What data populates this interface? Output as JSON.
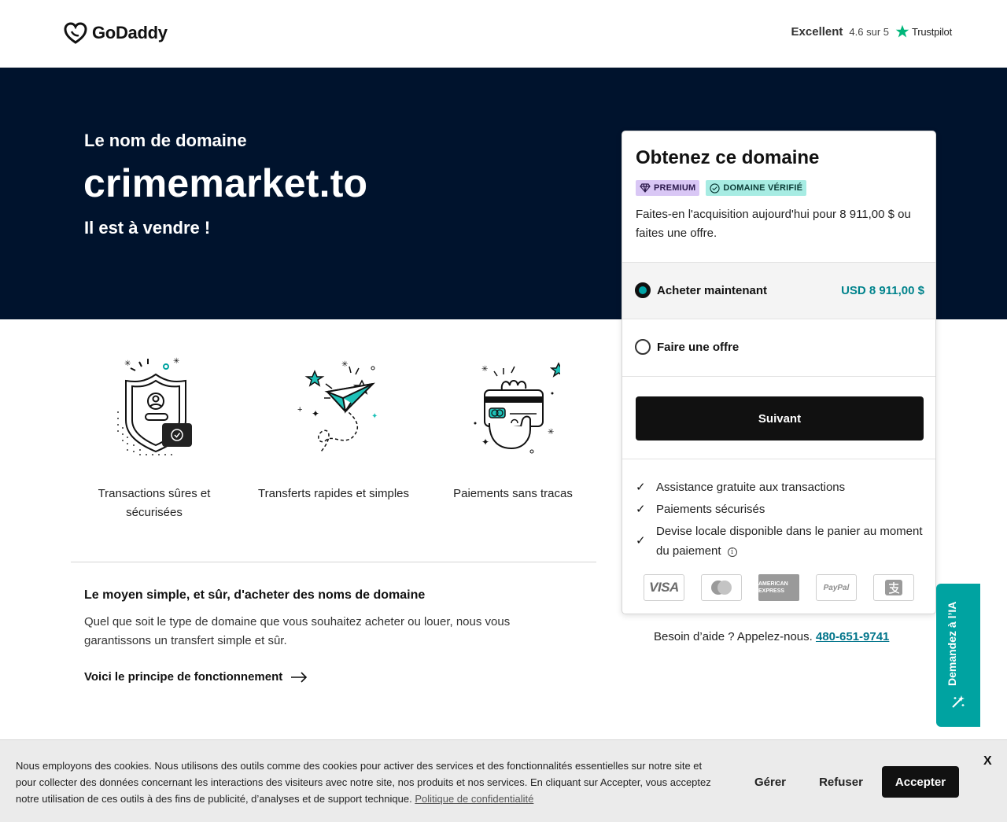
{
  "header": {
    "logo_text": "GoDaddy",
    "trust_excellent": "Excellent",
    "trust_score": "4.6 sur 5",
    "trust_brand": "Trustpilot"
  },
  "hero": {
    "kicker": "Le nom de domaine",
    "domain": "crimemarket.to",
    "sale": "Il est à vendre !"
  },
  "card": {
    "title": "Obtenez ce domaine",
    "badge_premium": "PREMIUM",
    "badge_verified": "DOMAINE VÉRIFIÉ",
    "description": "Faites-en l'acquisition aujourd'hui pour 8 911,00 $ ou faites une offre.",
    "buy_label": "Acheter maintenant",
    "buy_price": "USD 8 911,00 $",
    "offer_label": "Faire une offre",
    "next_button": "Suivant",
    "features": [
      "Assistance gratuite aux transactions",
      "Paiements sécurisés",
      "Devise locale disponible dans le panier au moment du paiement"
    ],
    "payments": [
      "VISA",
      "MasterCard",
      "AMERICAN EXPRESS",
      "PayPal",
      "Alipay"
    ]
  },
  "help": {
    "text": "Besoin d’aide ? Appelez-nous.",
    "phone": "480-651-9741"
  },
  "benefits": [
    {
      "label": "Transactions sûres et sécurisées",
      "icon": "shield-icon"
    },
    {
      "label": "Transferts rapides et simples",
      "icon": "paper-plane-icon"
    },
    {
      "label": "Paiements sans tracas",
      "icon": "card-payment-icon"
    }
  ],
  "how": {
    "title": "Le moyen simple, et sûr, d'acheter des noms de domaine",
    "text": "Quel que soit le type de domaine que vous souhaitez acheter ou louer, nous vous garantissons un transfert simple et sûr.",
    "link": "Voici le principe de fonctionnement"
  },
  "ai_tab": {
    "label": "Demandez à l’IA"
  },
  "cookie": {
    "text": "Nous employons des cookies. Nous utilisons des outils comme des cookies pour activer des services et des fonctionnalités essentielles sur notre site et pour collecter des données concernant les interactions des visiteurs avec notre site, nos produits et nos services. En cliquant sur Accepter, vous acceptez notre utilisation de ces outils à des fins de publicité, d’analyses et de support technique.",
    "policy_link": "Politique de confidentialité",
    "manage": "Gérer",
    "refuse": "Refuser",
    "accept": "Accepter",
    "close": "X"
  },
  "colors": {
    "hero_bg": "#00132d",
    "accent_teal": "#00a3a1",
    "price_teal": "#00838c",
    "premium_badge": "#d9c7f5",
    "verified_badge": "#a7ece3"
  }
}
